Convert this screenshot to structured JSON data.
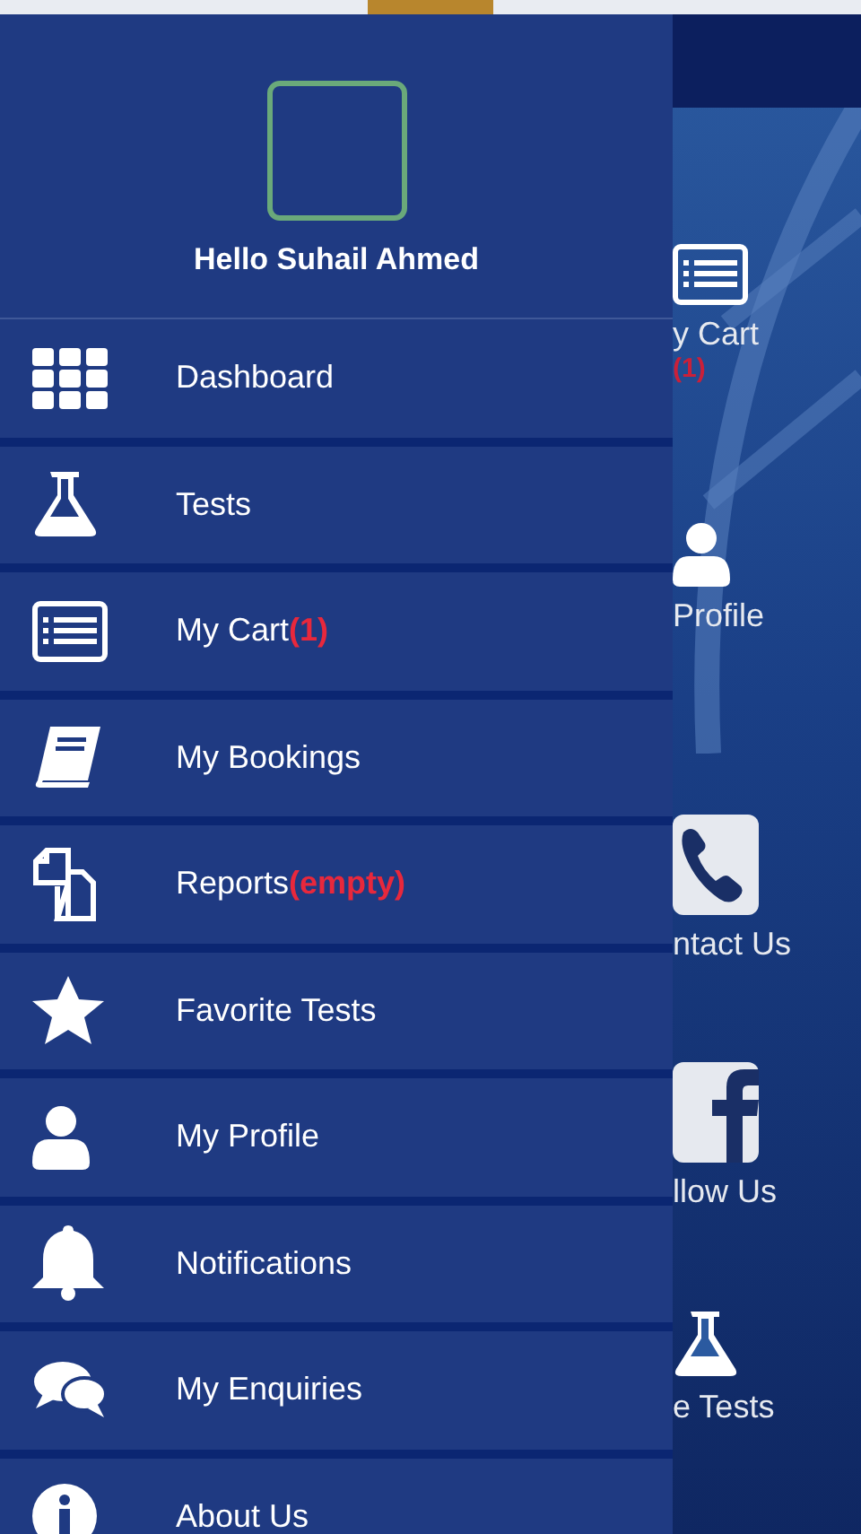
{
  "drawer": {
    "greeting": "Hello Suhail Ahmed",
    "items": [
      {
        "kind": "grid",
        "label": "Dashboard"
      },
      {
        "kind": "flask",
        "label": "Tests"
      },
      {
        "kind": "list",
        "label": "My Cart",
        "badge": "(1)"
      },
      {
        "kind": "book",
        "label": "My Bookings"
      },
      {
        "kind": "documents",
        "label": "Reports",
        "badge": "(empty)"
      },
      {
        "kind": "star",
        "label": "Favorite Tests"
      },
      {
        "kind": "person",
        "label": "My Profile"
      },
      {
        "kind": "bell",
        "label": "Notifications"
      },
      {
        "kind": "chat",
        "label": "My Enquiries"
      },
      {
        "kind": "info",
        "label": "About Us"
      }
    ]
  },
  "background_tiles": [
    {
      "kind": "list",
      "label": "y Cart",
      "badge": "(1)"
    },
    {
      "kind": "person",
      "label": "Profile"
    },
    {
      "kind": "phone",
      "label": "ntact Us"
    },
    {
      "kind": "social",
      "label": "llow Us"
    },
    {
      "kind": "flask",
      "label": "e Tests"
    }
  ]
}
